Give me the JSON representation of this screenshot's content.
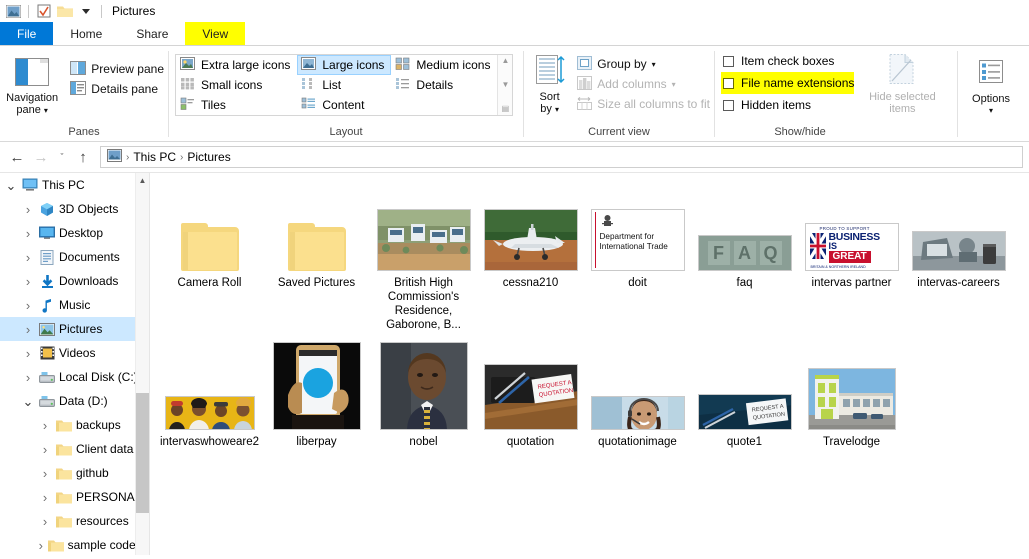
{
  "window": {
    "title": "Pictures",
    "quick_access": [
      "explorer-icon",
      "properties-icon",
      "new-folder-icon",
      "customize-dropdown"
    ]
  },
  "tabs": [
    {
      "label": "File",
      "state": "file"
    },
    {
      "label": "Home",
      "state": "normal"
    },
    {
      "label": "Share",
      "state": "normal"
    },
    {
      "label": "View",
      "state": "highlighted-active"
    }
  ],
  "ribbon": {
    "panes": {
      "group_label": "Panes",
      "navigation_pane": "Navigation\npane",
      "navigation_pane_line1": "Navigation",
      "navigation_pane_line2": "pane",
      "preview_pane": "Preview pane",
      "details_pane": "Details pane"
    },
    "layout": {
      "group_label": "Layout",
      "items": [
        {
          "label": "Extra large icons",
          "selected": false
        },
        {
          "label": "Large icons",
          "selected": true
        },
        {
          "label": "Medium icons",
          "selected": false
        },
        {
          "label": "Small icons",
          "selected": false
        },
        {
          "label": "List",
          "selected": false
        },
        {
          "label": "Details",
          "selected": false
        },
        {
          "label": "Tiles",
          "selected": false
        },
        {
          "label": "Content",
          "selected": false
        }
      ]
    },
    "current_view": {
      "group_label": "Current view",
      "sort_by_line1": "Sort",
      "sort_by_line2": "by",
      "group_by": "Group by",
      "add_columns": "Add columns",
      "size_all_columns": "Size all columns to fit"
    },
    "show_hide": {
      "group_label": "Show/hide",
      "item_check_boxes": "Item check boxes",
      "file_name_extensions": "File name extensions",
      "hidden_items": "Hidden items",
      "hide_selected_line1": "Hide selected",
      "hide_selected_line2": "items",
      "options": "Options",
      "highlight_color": "#ffff00"
    }
  },
  "address_bar": {
    "back": "←",
    "forward": "→",
    "recent": "ˇ",
    "up": "↑",
    "breadcrumbs": [
      "This PC",
      "Pictures"
    ]
  },
  "sidebar": {
    "items": [
      {
        "label": "This PC",
        "indent": 0,
        "twisty": "open",
        "icon": "pc-icon",
        "selected": false
      },
      {
        "label": "3D Objects",
        "indent": 1,
        "twisty": "closed",
        "icon": "3d-objects-icon",
        "selected": false
      },
      {
        "label": "Desktop",
        "indent": 1,
        "twisty": "closed",
        "icon": "desktop-icon",
        "selected": false
      },
      {
        "label": "Documents",
        "indent": 1,
        "twisty": "closed",
        "icon": "documents-icon",
        "selected": false
      },
      {
        "label": "Downloads",
        "indent": 1,
        "twisty": "closed",
        "icon": "downloads-icon",
        "selected": false
      },
      {
        "label": "Music",
        "indent": 1,
        "twisty": "closed",
        "icon": "music-icon",
        "selected": false
      },
      {
        "label": "Pictures",
        "indent": 1,
        "twisty": "closed",
        "icon": "pictures-icon",
        "selected": true
      },
      {
        "label": "Videos",
        "indent": 1,
        "twisty": "closed",
        "icon": "videos-icon",
        "selected": false
      },
      {
        "label": "Local Disk (C:)",
        "indent": 1,
        "twisty": "closed",
        "icon": "drive-icon",
        "selected": false
      },
      {
        "label": "Data  (D:)",
        "indent": 1,
        "twisty": "open",
        "icon": "drive-icon",
        "selected": false
      },
      {
        "label": "backups",
        "indent": 2,
        "twisty": "closed",
        "icon": "folder-icon",
        "selected": false
      },
      {
        "label": "Client data",
        "indent": 2,
        "twisty": "closed",
        "icon": "folder-icon",
        "selected": false
      },
      {
        "label": "github",
        "indent": 2,
        "twisty": "closed",
        "icon": "folder-icon",
        "selected": false
      },
      {
        "label": "PERSONAL",
        "indent": 2,
        "twisty": "closed",
        "icon": "folder-icon",
        "selected": false
      },
      {
        "label": "resources",
        "indent": 2,
        "twisty": "closed",
        "icon": "folder-icon",
        "selected": false
      },
      {
        "label": "sample code fo",
        "indent": 2,
        "twisty": "closed",
        "icon": "folder-icon",
        "selected": false
      }
    ]
  },
  "files": {
    "rows": [
      [
        {
          "name": "Camera Roll",
          "kind": "folder"
        },
        {
          "name": "Saved Pictures",
          "kind": "folder"
        },
        {
          "name": "British High Commission's Residence, Gaborone, B...",
          "kind": "photo",
          "thumb": "aerial-buildings"
        },
        {
          "name": "cessna210",
          "kind": "photo",
          "thumb": "airplane"
        },
        {
          "name": "doit",
          "kind": "photo",
          "thumb": "dit-logo"
        },
        {
          "name": "faq",
          "kind": "photo",
          "thumb": "faq-blocks"
        },
        {
          "name": "intervas partner",
          "kind": "photo",
          "thumb": "business-is-great"
        },
        {
          "name": "intervas-careers",
          "kind": "photo",
          "thumb": "desk-laptop"
        }
      ],
      [
        {
          "name": "intervaswhoweare2",
          "kind": "photo",
          "thumb": "people-collage"
        },
        {
          "name": "liberpay",
          "kind": "photo",
          "thumb": "phone-hand"
        },
        {
          "name": "nobel",
          "kind": "photo",
          "thumb": "portrait-man"
        },
        {
          "name": "quotation",
          "kind": "photo",
          "thumb": "desk-quote-card"
        },
        {
          "name": "quotationimage",
          "kind": "photo",
          "thumb": "headset-woman"
        },
        {
          "name": "quote1",
          "kind": "photo",
          "thumb": "quote-card-blue"
        },
        {
          "name": "Travelodge",
          "kind": "photo",
          "thumb": "hotel-building"
        }
      ]
    ]
  },
  "thumb_labels": {
    "dit_line1": "Department for",
    "dit_line2": "International Trade",
    "faq_text": "FAQ",
    "big_proud": "PROUD TO SUPPORT",
    "big_business": "BUSINESS",
    "big_is": "IS",
    "big_great": "GREAT",
    "big_foot": "BRITAIN & NORTHERN IRELAND",
    "quote_line1": "REQUEST A",
    "quote_line2": "QUOTATION"
  }
}
